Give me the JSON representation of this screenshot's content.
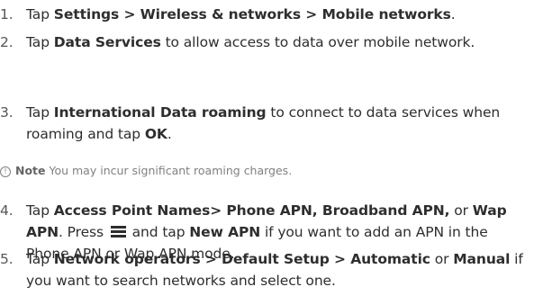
{
  "steps": [
    {
      "number": "1.",
      "parts": [
        "Tap ",
        "Settings > Wireless & networks > Mobile networks",
        "."
      ]
    },
    {
      "number": "2.",
      "parts": [
        "Tap ",
        "Data Services",
        " to allow access to data over mobile network."
      ]
    },
    {
      "number": "3.",
      "parts": [
        "Tap ",
        "International Data roaming",
        " to connect to data services when roaming and tap ",
        "OK",
        "."
      ]
    },
    {
      "number": "4.",
      "parts": [
        "Tap ",
        "Access Point Names> Phone APN, Broadband APN,",
        " or ",
        "Wap APN",
        ". Press ",
        " and tap ",
        "New APN",
        " if you want to add an APN in the Phone APN or Wap APN mode."
      ]
    },
    {
      "number": "5.",
      "parts": [
        "Tap ",
        "Network operators > Default Setup > Automatic",
        " or ",
        "Manual",
        " if you want to search networks and select one."
      ]
    }
  ],
  "note": {
    "icon": "info-circle-icon",
    "label": "Note",
    "text": " You may incur significant roaming charges."
  },
  "menu_icon": "menu-key-icon"
}
